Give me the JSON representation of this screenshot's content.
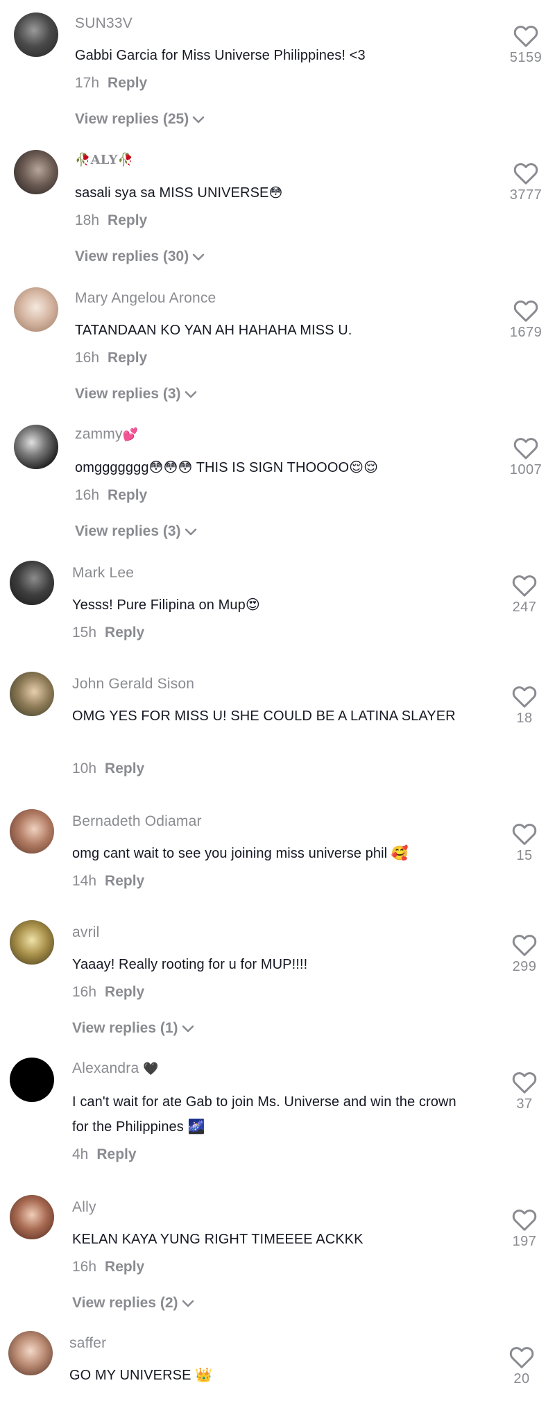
{
  "comments": [
    {
      "username": "SUN33V",
      "text": "Gabbi Garcia for Miss Universe Philippines! <3",
      "time": "17h",
      "reply_label": "Reply",
      "view_replies": "View replies (25)",
      "likes": "5159",
      "avatar_colors": [
        "#3a3a3a",
        "#6a6a6a"
      ]
    },
    {
      "username": "ALY",
      "text": "sasali sya sa MISS UNIVERSE",
      "text_emoji": "😳",
      "time": "18h",
      "reply_label": "Reply",
      "view_replies": "View replies (30)",
      "likes": "3777",
      "avatar_colors": [
        "#2a2624",
        "#8b7d74"
      ]
    },
    {
      "username": "Mary Angelou Aronce",
      "text": "TATANDAAN KO YAN AH HAHAHA MISS U.",
      "time": "16h",
      "reply_label": "Reply",
      "view_replies": "View replies (3)",
      "likes": "1679",
      "avatar_colors": [
        "#c8a48c",
        "#f3e6dc"
      ]
    },
    {
      "username": "zammy",
      "username_emoji": "💕",
      "text": "omggggggg😳😳😳 THIS IS SIGN THOOOO😌😌",
      "time": "16h",
      "reply_label": "Reply",
      "view_replies": "View replies (3)",
      "likes": "1007",
      "avatar_colors": [
        "#1d1d1d",
        "#d6d6d6"
      ]
    },
    {
      "username": "Mark Lee",
      "text": "Yesss! Pure Filipina on Mup😍",
      "time": "15h",
      "reply_label": "Reply",
      "likes": "247",
      "avatar_colors": [
        "#2b2b2b",
        "#7a7a7a"
      ]
    },
    {
      "username": "John Gerald Sison",
      "text": "OMG YES FOR MISS U! SHE COULD BE A LATINA SLAYER",
      "time": "10h",
      "reply_label": "Reply",
      "likes": "18",
      "avatar_colors": [
        "#3c4a2c",
        "#c9b08a"
      ]
    },
    {
      "username": "Bernadeth Odiamar",
      "text": "omg cant wait to see you joining miss universe phil 🥰",
      "time": "14h",
      "reply_label": "Reply",
      "likes": "15",
      "avatar_colors": [
        "#6b3f2e",
        "#d7a98f"
      ]
    },
    {
      "username": "avril",
      "text": "Yaaay! Really rooting for u for MUP!!!!",
      "time": "16h",
      "reply_label": "Reply",
      "view_replies": "View replies (1)",
      "likes": "299",
      "avatar_colors": [
        "#6a5a2a",
        "#cdb46a"
      ]
    },
    {
      "username": "Alexandra",
      "username_emoji": "🖤",
      "text": "I can't wait for ate Gab to join Ms. Universe and win the crown for the Philippines 🌌",
      "time": "4h",
      "reply_label": "Reply",
      "likes": "37",
      "avatar_colors": [
        "#000000",
        "#000000"
      ]
    },
    {
      "username": "Ally",
      "text": "KELAN KAYA YUNG RIGHT TIMEEEE ACKKK",
      "time": "16h",
      "reply_label": "Reply",
      "view_replies": "View replies (2)",
      "likes": "197",
      "avatar_colors": [
        "#5a3428",
        "#e0b49c"
      ]
    },
    {
      "username": "saffer",
      "text": "GO MY UNIVERSE 👑",
      "likes": "20",
      "avatar_colors": [
        "#4a2e26",
        "#dcb8a6"
      ]
    }
  ],
  "icons": {
    "like": "heart-outline-icon",
    "expand": "chevron-down-icon"
  },
  "colors": {
    "secondary_text": "#8a8b91",
    "primary_text": "#161823"
  }
}
